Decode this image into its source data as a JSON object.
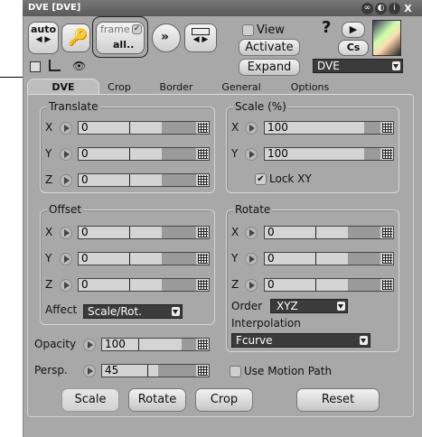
{
  "window": {
    "title": "DVE [DVE]"
  },
  "toolbar": {
    "auto_label": "auto",
    "frame_label": "frame",
    "all_label": "all..",
    "view_label": "View",
    "activate_label": "Activate",
    "expand_label": "Expand",
    "preset_value": "DVE"
  },
  "tabs": [
    "DVE",
    "Crop",
    "Border",
    "General",
    "Options"
  ],
  "translate": {
    "title": "Translate",
    "rows": [
      {
        "axis": "X",
        "value": "0"
      },
      {
        "axis": "Y",
        "value": "0"
      },
      {
        "axis": "Z",
        "value": "0"
      }
    ]
  },
  "scale": {
    "title": "Scale (%)",
    "rows": [
      {
        "axis": "X",
        "value": "100"
      },
      {
        "axis": "Y",
        "value": "100"
      }
    ],
    "lock_label": "Lock XY",
    "lock_checked": true
  },
  "offset": {
    "title": "Offset",
    "rows": [
      {
        "axis": "X",
        "value": "0"
      },
      {
        "axis": "Y",
        "value": "0"
      },
      {
        "axis": "Z",
        "value": "0"
      }
    ],
    "affect_label": "Affect",
    "affect_value": "Scale/Rot."
  },
  "rotate": {
    "title": "Rotate",
    "rows": [
      {
        "axis": "X",
        "value": "0"
      },
      {
        "axis": "Y",
        "value": "0"
      },
      {
        "axis": "Z",
        "value": "0"
      }
    ],
    "order_label": "Order",
    "order_value": "XYZ",
    "interp_label": "Interpolation",
    "interp_value": "Fcurve"
  },
  "opacity": {
    "label": "Opacity",
    "value": "100"
  },
  "persp": {
    "label": "Persp.",
    "value": "45"
  },
  "motion_path_label": "Use Motion Path",
  "buttons": {
    "scale": "Scale",
    "rotate": "Rotate",
    "crop": "Crop",
    "reset": "Reset"
  },
  "icons": [
    "key-icon",
    "arrows-icon",
    "help-icon",
    "camera-icon",
    "avatar-icon",
    "close-icon"
  ]
}
